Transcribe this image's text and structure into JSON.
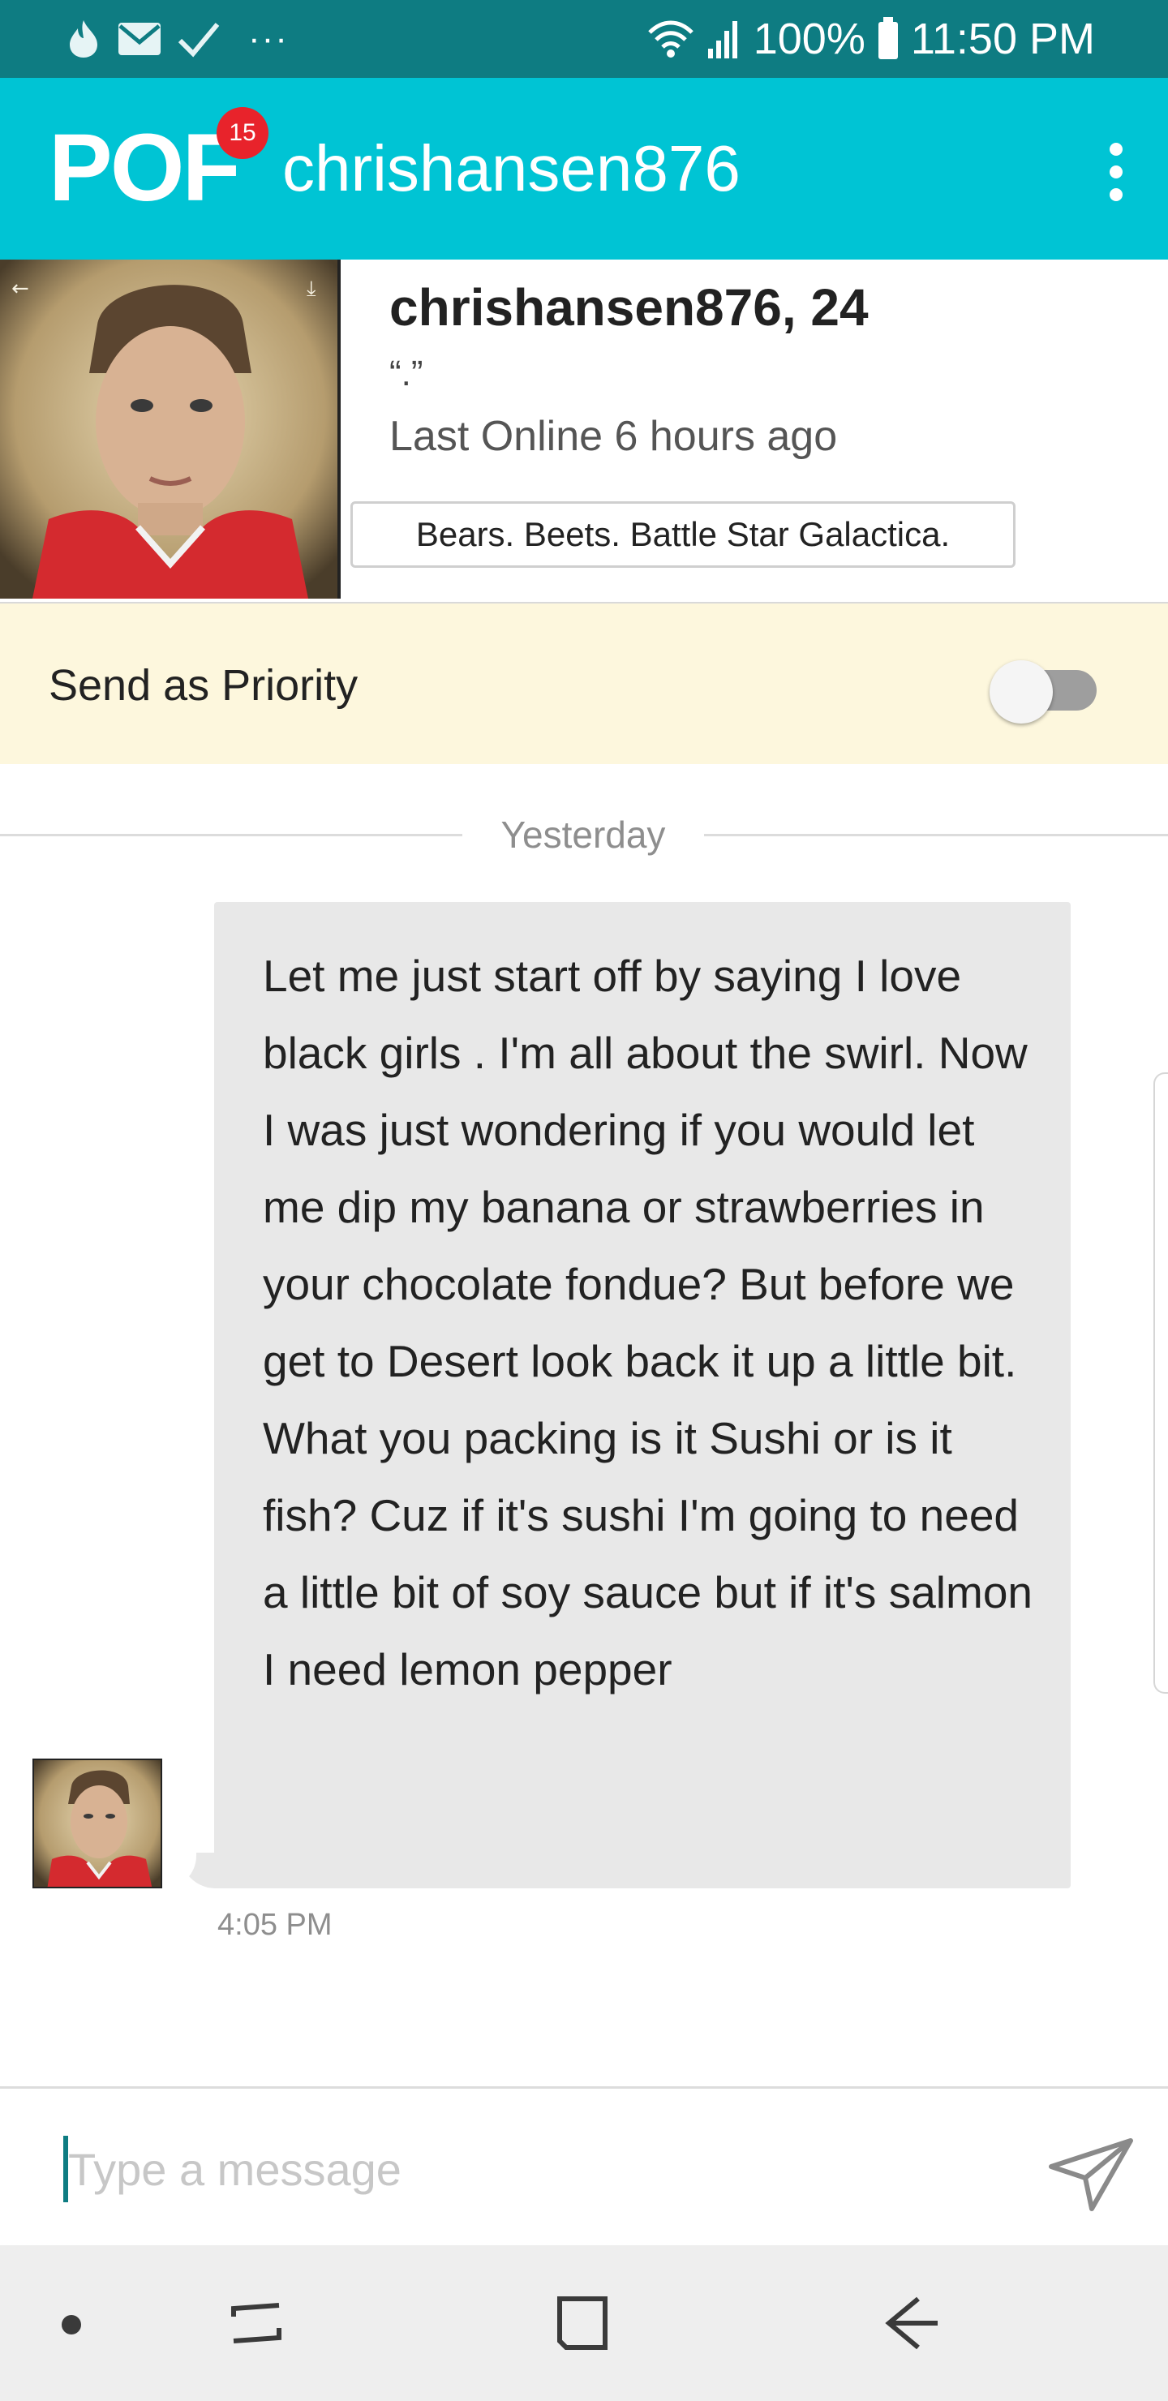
{
  "status_bar": {
    "battery": "100%",
    "time": "11:50 PM",
    "more": "···"
  },
  "app_bar": {
    "logo": "POF",
    "badge_count": "15",
    "title": "chrishansen876"
  },
  "profile": {
    "name_age": "chrishansen876, 24",
    "quote": "“.”",
    "last_online": "Last Online 6 hours ago",
    "headline": "Bears. Beets. Battle Star Galactica."
  },
  "priority": {
    "label": "Send as Priority",
    "enabled": false
  },
  "conversation": {
    "day_label": "Yesterday",
    "messages": [
      {
        "text": "Let me just start off by saying I love black girls . I'm all about the swirl. Now I was just wondering if you would let me dip my banana or strawberries in your chocolate fondue? But before we get to Desert look back it up a little bit. What you packing is it Sushi or is it fish? Cuz if it's sushi I'm going to need a little bit of soy sauce but if it's salmon I need lemon pepper",
        "time": "4:05 PM"
      }
    ]
  },
  "composer": {
    "placeholder": "Type a message"
  },
  "icons": {
    "status_left": [
      "flame-icon",
      "mail-icon",
      "check-icon"
    ],
    "status_right": [
      "wifi-icon",
      "signal-icon",
      "battery-icon"
    ],
    "composer": "send-icon",
    "nav": [
      "nav-dot-icon",
      "recents-icon",
      "home-icon",
      "back-icon"
    ]
  },
  "colors": {
    "status_bar": "#0e7c82",
    "app_bar": "#00c4d4",
    "badge": "#e8232b",
    "priority_bg": "#fdf7dd",
    "bubble": "#e8e8e8"
  }
}
